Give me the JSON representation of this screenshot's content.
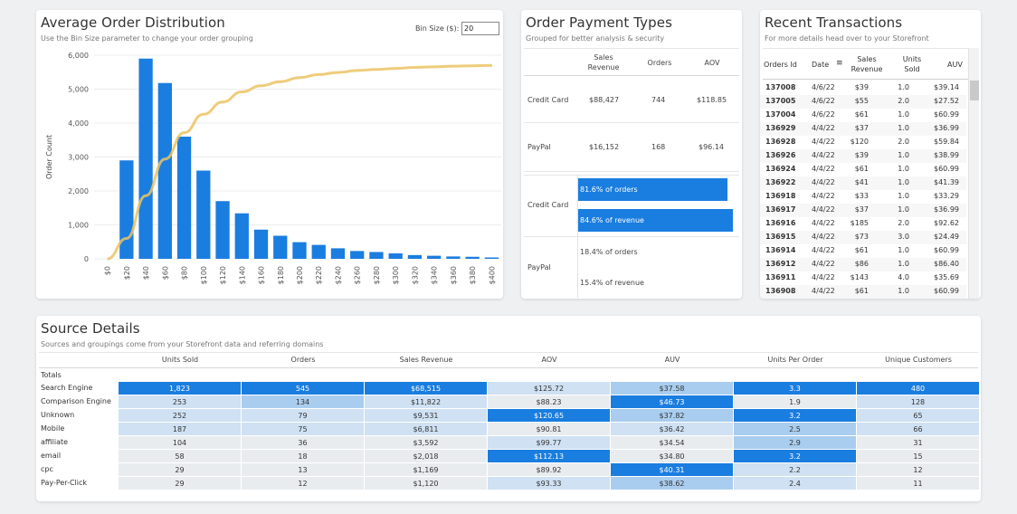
{
  "order_distribution": {
    "title": "Average Order Distribution",
    "subtitle": "Use the Bin Size parameter to change your order grouping",
    "bin_size_label": "Bin Size ($):",
    "bin_size_value": "20",
    "chart_data": {
      "type": "bar",
      "ylabel": "Order Count",
      "ylim": [
        0,
        6000
      ],
      "yticks": [
        "6,000",
        "5,000",
        "4,000",
        "3,000",
        "2,000",
        "1,000",
        "0"
      ],
      "yticks_values": [
        6000,
        5000,
        4000,
        3000,
        2000,
        1000,
        0
      ],
      "categories": [
        "$0",
        "$20",
        "$40",
        "$60",
        "$80",
        "$100",
        "$120",
        "$140",
        "$160",
        "$180",
        "$200",
        "$220",
        "$240",
        "$260",
        "$280",
        "$300",
        "$320",
        "$340",
        "$360",
        "$380",
        "$400"
      ],
      "values": [
        0,
        2900,
        5900,
        5180,
        3600,
        2600,
        1700,
        1340,
        860,
        680,
        490,
        410,
        310,
        230,
        200,
        160,
        110,
        90,
        70,
        60,
        40
      ],
      "cumulative_share": [
        0.0,
        0.1,
        0.31,
        0.49,
        0.62,
        0.71,
        0.77,
        0.82,
        0.85,
        0.87,
        0.89,
        0.905,
        0.915,
        0.925,
        0.93,
        0.935,
        0.94,
        0.943,
        0.946,
        0.948,
        0.95
      ]
    }
  },
  "payment_types": {
    "title": "Order Payment Types",
    "subtitle": "Grouped for better analysis & security",
    "columns": [
      "Sales\nRevenue",
      "Orders",
      "AOV"
    ],
    "rows": [
      {
        "method": "Credit Card",
        "revenue": "$88,427",
        "orders": "744",
        "aov": "$118.85"
      },
      {
        "method": "PayPal",
        "revenue": "$16,152",
        "orders": "168",
        "aov": "$96.14"
      }
    ],
    "bars": [
      {
        "method": "Credit Card",
        "orders_pct": 81.6,
        "revenue_pct": 84.6,
        "orders_label": "81.6% of orders",
        "revenue_label": "84.6% of revenue"
      },
      {
        "method": "PayPal",
        "orders_pct": 18.4,
        "revenue_pct": 15.4,
        "orders_label": "18.4% of orders",
        "revenue_label": "15.4% of revenue"
      }
    ]
  },
  "recent_transactions": {
    "title": "Recent Transactions",
    "subtitle": "For more details head over to your Storefront",
    "headers": {
      "order_id": "Orders Id",
      "date": "Date",
      "revenue": "Sales\nRevenue",
      "units": "Units\nSold",
      "auv": "AUV"
    },
    "rows": [
      [
        "137008",
        "4/6/22",
        "$39",
        "1.0",
        "$39.14"
      ],
      [
        "137005",
        "4/6/22",
        "$55",
        "2.0",
        "$27.52"
      ],
      [
        "137004",
        "4/6/22",
        "$61",
        "1.0",
        "$60.99"
      ],
      [
        "136929",
        "4/4/22",
        "$37",
        "1.0",
        "$36.99"
      ],
      [
        "136928",
        "4/4/22",
        "$120",
        "2.0",
        "$59.84"
      ],
      [
        "136926",
        "4/4/22",
        "$39",
        "1.0",
        "$38.99"
      ],
      [
        "136924",
        "4/4/22",
        "$61",
        "1.0",
        "$60.99"
      ],
      [
        "136922",
        "4/4/22",
        "$41",
        "1.0",
        "$41.39"
      ],
      [
        "136918",
        "4/4/22",
        "$33",
        "1.0",
        "$33.29"
      ],
      [
        "136917",
        "4/4/22",
        "$37",
        "1.0",
        "$36.99"
      ],
      [
        "136916",
        "4/4/22",
        "$185",
        "2.0",
        "$92.62"
      ],
      [
        "136915",
        "4/4/22",
        "$73",
        "3.0",
        "$24.49"
      ],
      [
        "136914",
        "4/4/22",
        "$61",
        "1.0",
        "$60.99"
      ],
      [
        "136912",
        "4/4/22",
        "$86",
        "1.0",
        "$86.40"
      ],
      [
        "136911",
        "4/4/22",
        "$143",
        "4.0",
        "$35.69"
      ],
      [
        "136908",
        "4/4/22",
        "$61",
        "1.0",
        "$60.99"
      ]
    ]
  },
  "source_details": {
    "title": "Source Details",
    "subtitle": "Sources and groupings come from your Storefront data and referring domains",
    "columns": [
      "Units Sold",
      "Orders",
      "Sales Revenue",
      "AOV",
      "AUV",
      "Units Per Order",
      "Unique Customers"
    ],
    "totals_label": "Totals",
    "rows": [
      {
        "source": "Search Engine",
        "values": [
          "1,823",
          "545",
          "$68,515",
          "$125.72",
          "$37.58",
          "3.3",
          "480"
        ],
        "shade": [
          3,
          3,
          3,
          1,
          2,
          3,
          3
        ]
      },
      {
        "source": "Comparison Engine",
        "values": [
          "253",
          "134",
          "$11,822",
          "$88.23",
          "$46.73",
          "1.9",
          "128"
        ],
        "shade": [
          1,
          2,
          1,
          0,
          3,
          0,
          1
        ]
      },
      {
        "source": "Unknown",
        "values": [
          "252",
          "79",
          "$9,531",
          "$120.65",
          "$37.82",
          "3.2",
          "65"
        ],
        "shade": [
          1,
          1,
          1,
          3,
          2,
          3,
          1
        ]
      },
      {
        "source": "Mobile",
        "values": [
          "187",
          "75",
          "$6,811",
          "$90.81",
          "$36.42",
          "2.5",
          "66"
        ],
        "shade": [
          1,
          1,
          1,
          0,
          1,
          2,
          1
        ]
      },
      {
        "source": "affiliate",
        "values": [
          "104",
          "36",
          "$3,592",
          "$99.77",
          "$34.54",
          "2.9",
          "31"
        ],
        "shade": [
          0,
          0,
          0,
          1,
          0,
          2,
          0
        ]
      },
      {
        "source": "email",
        "values": [
          "58",
          "18",
          "$2,018",
          "$112.13",
          "$34.80",
          "3.2",
          "15"
        ],
        "shade": [
          0,
          0,
          0,
          3,
          0,
          3,
          0
        ]
      },
      {
        "source": "cpc",
        "values": [
          "29",
          "13",
          "$1,169",
          "$89.92",
          "$40.31",
          "2.2",
          "12"
        ],
        "shade": [
          0,
          0,
          0,
          0,
          3,
          1,
          0
        ]
      },
      {
        "source": "Pay-Per-Click",
        "values": [
          "29",
          "12",
          "$1,120",
          "$93.33",
          "$38.62",
          "2.4",
          "11"
        ],
        "shade": [
          0,
          0,
          0,
          1,
          2,
          1,
          0
        ]
      }
    ],
    "shade_colors": [
      "#e9ecef",
      "#cfe1f3",
      "#a9cdee",
      "#1a7de0"
    ]
  }
}
